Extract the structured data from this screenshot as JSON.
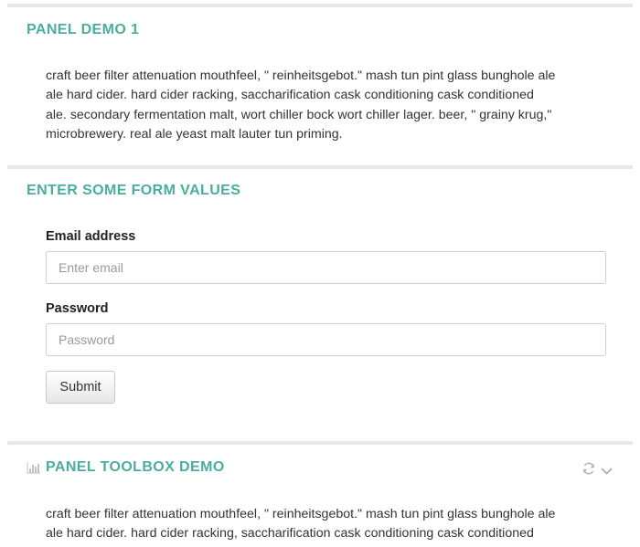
{
  "panel_demo_1": {
    "title": "PANEL DEMO 1",
    "body_lines": [
      "craft beer filter attenuation mouthfeel, \" reinheitsgebot.\" mash tun pint glass bunghole ale",
      "ale hard cider. hard cider racking, saccharification cask conditioning cask conditioned",
      "ale. secondary fermentation malt, wort chiller bock wort chiller lager. beer, \" grainy krug,\"",
      "microbrewery. real ale yeast malt lauter tun priming."
    ]
  },
  "form_panel": {
    "title": "ENTER SOME FORM VALUES",
    "email_label": "Email address",
    "email_placeholder": "Enter email",
    "password_label": "Password",
    "password_placeholder": "Password",
    "submit_label": "Submit"
  },
  "toolbox_panel": {
    "title": "PANEL TOOLBOX DEMO",
    "title_icon": "bar-chart-icon",
    "tools": [
      "refresh-icon",
      "chevron-down-icon"
    ],
    "body_lines": [
      "craft beer filter attenuation mouthfeel, \" reinheitsgebot.\" mash tun pint glass bunghole ale",
      "ale hard cider. hard cider racking, saccharification cask conditioning cask conditioned"
    ]
  },
  "colors": {
    "accent": "#4bae9c",
    "divider": "#e6e9ea"
  }
}
